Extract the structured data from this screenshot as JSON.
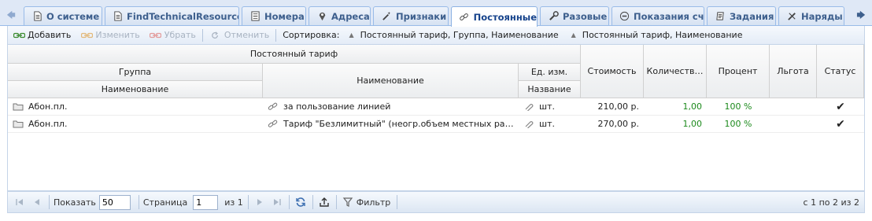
{
  "tabs": [
    {
      "label": "О системе",
      "icon": "document-icon",
      "active": false
    },
    {
      "label": "FindTechnicalResources",
      "icon": "document-icon",
      "active": false
    },
    {
      "label": "Номера",
      "icon": "list-icon",
      "active": false
    },
    {
      "label": "Адреса",
      "icon": "map-pin-icon",
      "active": false
    },
    {
      "label": "Признаки",
      "icon": "wand-icon",
      "active": false
    },
    {
      "label": "Постоянные",
      "icon": "link-icon",
      "active": true
    },
    {
      "label": "Разовые",
      "icon": "wrench-icon",
      "active": false
    },
    {
      "label": "Показания сч.",
      "icon": "meter-icon",
      "active": false
    },
    {
      "label": "Задания",
      "icon": "task-icon",
      "active": false
    },
    {
      "label": "Наряды",
      "icon": "tools-icon",
      "active": false
    }
  ],
  "toolbar": {
    "add_label": "Добавить",
    "edit_label": "Изменить",
    "remove_label": "Убрать",
    "undo_label": "Отменить",
    "sort_label": "Сортировка:",
    "sort_chips": [
      "Постоянный тариф, Группа, Наименование",
      "Постоянный тариф, Наименование"
    ]
  },
  "grid": {
    "headers": {
      "group_top": "Постоянный тариф",
      "group": "Группа",
      "group_name": "Наименование",
      "name": "Наименование",
      "unit_group": "Ед. изм.",
      "unit_name": "Название",
      "cost": "Стоимость",
      "quantity": "Количеств…",
      "percent": "Процент",
      "benefit": "Льгота",
      "status": "Статус"
    },
    "rows": [
      {
        "group": "Абон.пл.",
        "name": "за пользование линией",
        "unit": "шт.",
        "cost": "210,00 р.",
        "quantity": "1,00",
        "percent": "100 %",
        "benefit": "",
        "status": "✔"
      },
      {
        "group": "Абон.пл.",
        "name": "Тариф \"Безлимитный\" (неогр.объем местных разговор…",
        "unit": "шт.",
        "cost": "270,00 р.",
        "quantity": "1,00",
        "percent": "100 %",
        "benefit": "",
        "status": "✔"
      }
    ]
  },
  "pager": {
    "show_label": "Показать",
    "page_size": "50",
    "page_label": "Страница",
    "page": "1",
    "of_label": "из 1",
    "filter_label": "Фильтр",
    "info": "с 1 по 2 из 2"
  },
  "colors": {
    "tab_text": "#15428b",
    "header_border": "#99bbe8",
    "green_value": "#1c8a1c"
  }
}
